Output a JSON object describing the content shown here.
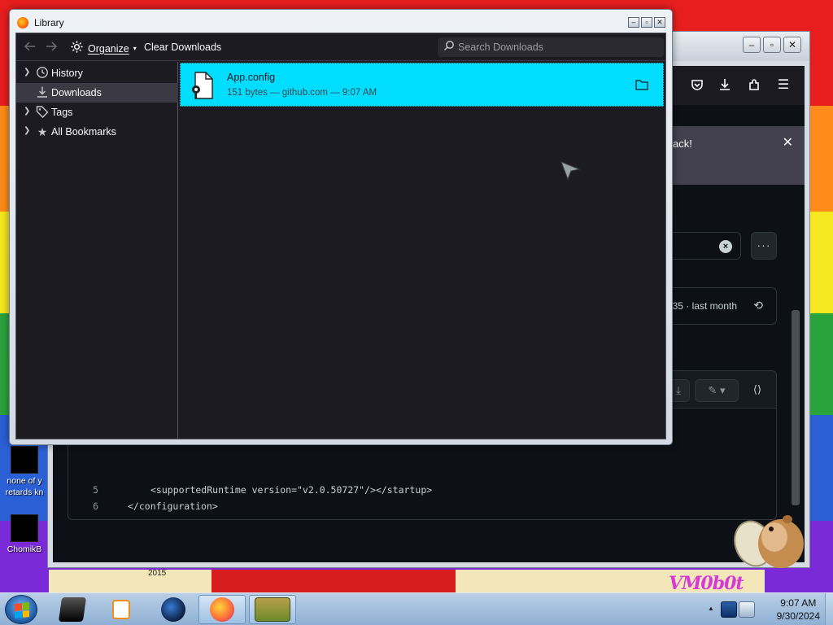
{
  "desktop": {
    "icons": [
      {
        "label": "none of y\nretards kn"
      },
      {
        "label": "ChomikB"
      }
    ],
    "bottom_text": "2015",
    "watermark": "VM0b0t"
  },
  "browser": {
    "notification_text": "ack!",
    "commit_text": "35 · last month",
    "code_lines": [
      {
        "number": "5",
        "content": "<supportedRuntime version=\"v2.0.50727\"/></startup>"
      },
      {
        "number": "6",
        "content": "</configuration>"
      }
    ]
  },
  "library": {
    "title": "Library",
    "toolbar": {
      "back_icon": "back-arrow-icon",
      "forward_icon": "forward-arrow-icon",
      "organize_label": "Organize",
      "clear_downloads_label": "Clear Downloads",
      "search_placeholder": "Search Downloads"
    },
    "sidebar": [
      {
        "label": "History",
        "icon": "clock-icon",
        "expandable": true,
        "selected": false
      },
      {
        "label": "Downloads",
        "icon": "download-icon",
        "expandable": false,
        "selected": true
      },
      {
        "label": "Tags",
        "icon": "tag-icon",
        "expandable": true,
        "selected": false
      },
      {
        "label": "All Bookmarks",
        "icon": "star-icon",
        "expandable": true,
        "selected": false
      }
    ],
    "downloads": [
      {
        "name": "App.config",
        "meta": "151 bytes — github.com — 9:07 AM"
      }
    ]
  },
  "taskbar": {
    "clock_time": "9:07 AM",
    "clock_date": "9/30/2024"
  },
  "colors": {
    "accent_cyan": "#00ddff",
    "dark_bg": "#1c1b22"
  }
}
